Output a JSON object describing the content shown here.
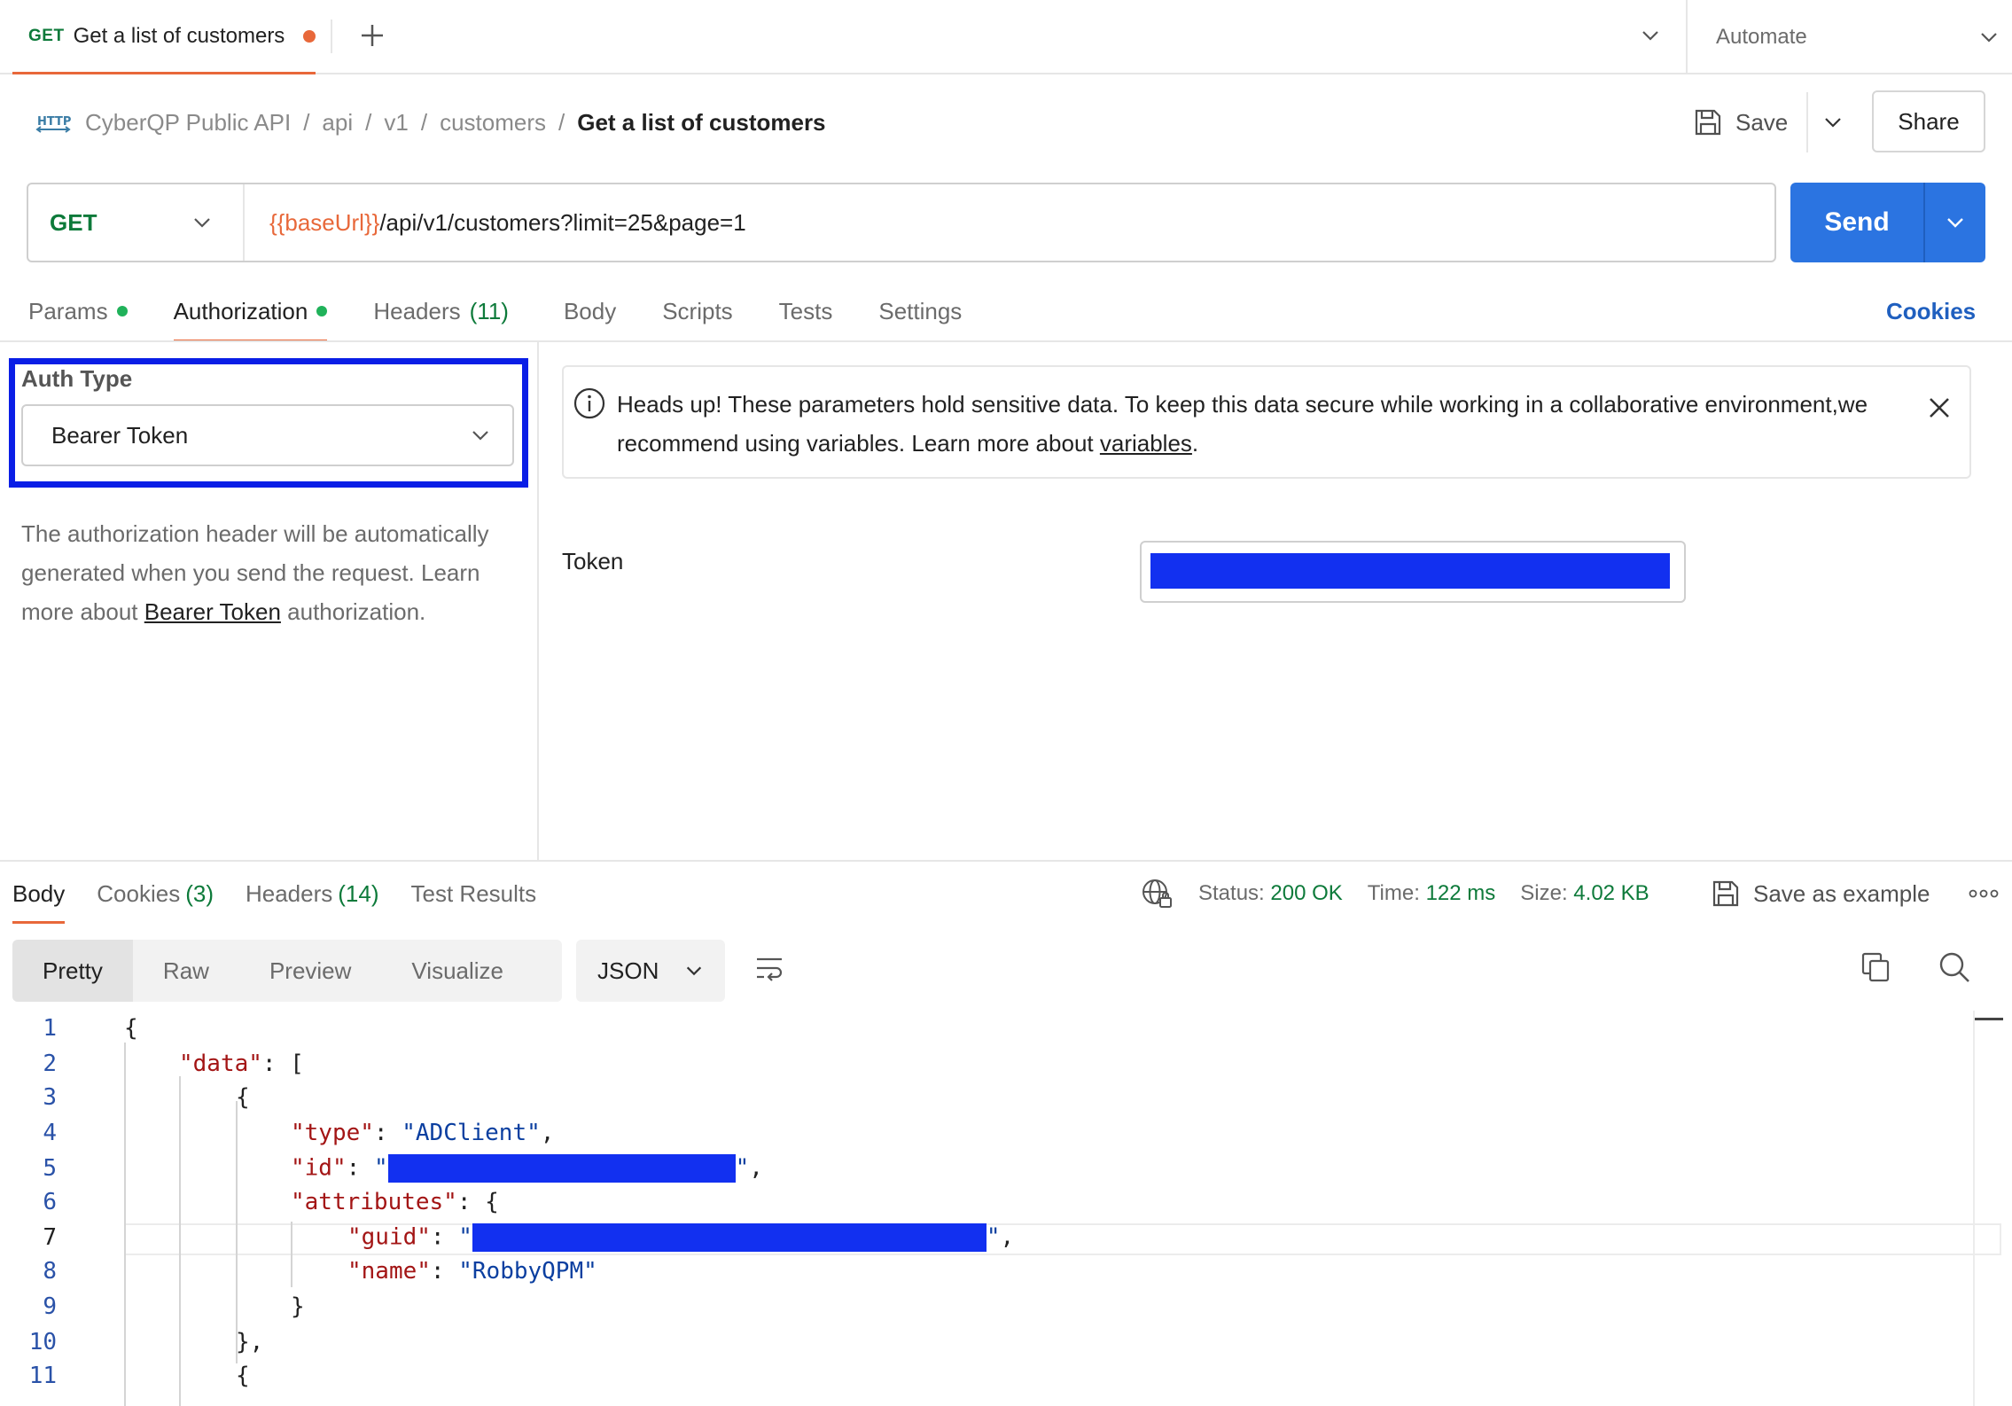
{
  "tab": {
    "method": "GET",
    "title": "Get a list of customers",
    "new_tab_icon": "plus-icon"
  },
  "environment": {
    "selected": "Automate"
  },
  "breadcrumb": {
    "items": [
      "CyberQP Public API",
      "api",
      "v1",
      "customers"
    ],
    "separator": "/",
    "current": "Get a list of customers"
  },
  "toolbar": {
    "save_label": "Save",
    "share_label": "Share"
  },
  "request": {
    "method": "GET",
    "url_variable": "{{baseUrl}}",
    "url_path": "/api/v1/customers?limit=25&page=1",
    "send_label": "Send"
  },
  "request_tabs": {
    "params": "Params",
    "authorization": "Authorization",
    "headers": "Headers",
    "headers_count": "(11)",
    "body": "Body",
    "scripts": "Scripts",
    "tests": "Tests",
    "settings": "Settings",
    "cookies": "Cookies"
  },
  "auth": {
    "type_label": "Auth Type",
    "type_value": "Bearer Token",
    "desc_before": "The authorization header will be automatically generated when you send the request. Learn more about ",
    "desc_link": "Bearer Token",
    "desc_after": " authorization.",
    "banner_text": "Heads up! These parameters hold sensitive data. To keep this data secure while working in a collaborative environment,we recommend using variables. Learn more about ",
    "banner_link": "variables",
    "banner_after": ".",
    "token_label": "Token"
  },
  "response_tabs": {
    "body": "Body",
    "cookies": "Cookies",
    "cookies_count": "(3)",
    "headers": "Headers",
    "headers_count": "(14)",
    "test_results": "Test Results"
  },
  "response_stats": {
    "status_label": "Status:",
    "status_value": "200 OK",
    "time_label": "Time:",
    "time_value": "122 ms",
    "size_label": "Size:",
    "size_value": "4.02 KB",
    "save_example": "Save as example"
  },
  "view_modes": {
    "pretty": "Pretty",
    "raw": "Raw",
    "preview": "Preview",
    "visualize": "Visualize",
    "format": "JSON"
  },
  "code": {
    "line_numbers": [
      "1",
      "2",
      "3",
      "4",
      "5",
      "6",
      "7",
      "8",
      "9",
      "10",
      "11"
    ],
    "key_data": "\"data\"",
    "key_type": "\"type\"",
    "val_type": "\"ADClient\"",
    "key_id": "\"id\"",
    "key_attributes": "\"attributes\"",
    "key_guid": "\"guid\"",
    "key_name": "\"name\"",
    "val_name": "\"RobbyQPM\""
  },
  "colors": {
    "accent_orange": "#e8683a",
    "send_blue": "#2b74e1",
    "link_blue": "#1f5fbf",
    "method_green": "#0d7a3a",
    "redaction_blue": "#1230f0"
  }
}
